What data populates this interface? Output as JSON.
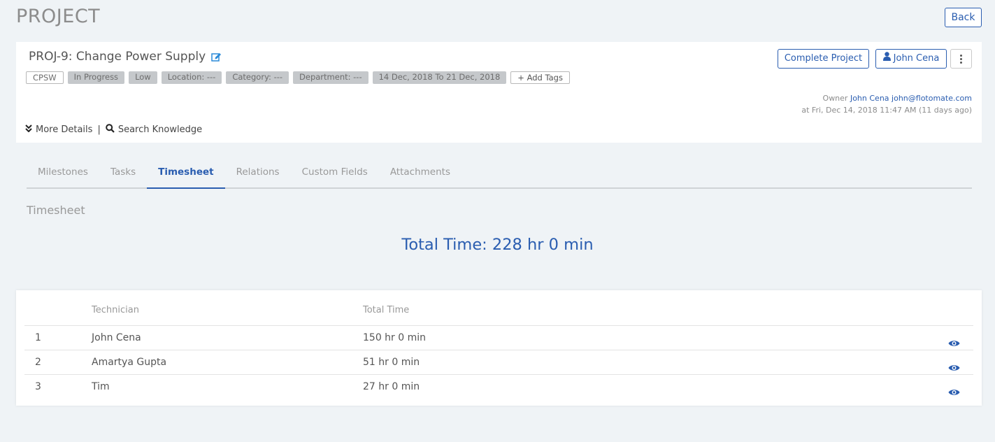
{
  "page": {
    "title": "PROJECT",
    "back_label": "Back"
  },
  "project": {
    "title": "PROJ-9: Change Power Supply",
    "tags": [
      "CPSW",
      "In Progress",
      "Low",
      "Location: ---",
      "Category: ---",
      "Department: ---",
      "14 Dec, 2018 To 21 Dec, 2018"
    ],
    "add_tags_label": "+ Add Tags",
    "complete_label": "Complete Project",
    "assignee_label": "John Cena",
    "owner_prefix": "Owner",
    "owner_name": "John Cena",
    "owner_email": "john@flotomate.com",
    "created_text": "at Fri, Dec 14, 2018 11:47 AM (11 days ago)",
    "more_details_label": "More Details",
    "search_knowledge_label": "Search Knowledge"
  },
  "tabs": [
    "Milestones",
    "Tasks",
    "Timesheet",
    "Relations",
    "Custom Fields",
    "Attachments"
  ],
  "active_tab": "Timesheet",
  "timesheet": {
    "section_title": "Timesheet",
    "total_time": "Total Time: 228 hr 0 min",
    "columns": [
      "Technician",
      "Total Time"
    ],
    "rows": [
      {
        "num": "1",
        "technician": "John Cena",
        "total_time": "150 hr 0 min"
      },
      {
        "num": "2",
        "technician": "Amartya Gupta",
        "total_time": "51 hr 0 min"
      },
      {
        "num": "3",
        "technician": "Tim",
        "total_time": "27 hr 0 min"
      }
    ]
  },
  "colors": {
    "accent": "#2a5db0",
    "background": "#eff3f6",
    "tag_bg": "#c5c8cb"
  },
  "icons": {
    "edit": "edit-icon",
    "user": "user-icon",
    "more": "kebab-icon",
    "expand": "double-chevron-down-icon",
    "search": "search-icon",
    "view": "eye-icon"
  }
}
